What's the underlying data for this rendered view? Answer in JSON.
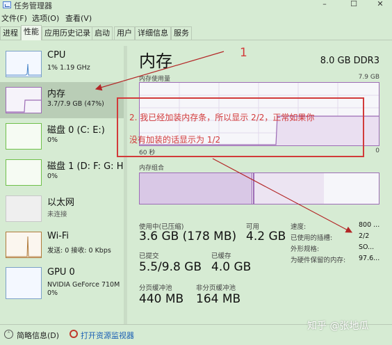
{
  "window": {
    "title": "任务管理器",
    "controls": [
      "–",
      "☐",
      "✕"
    ]
  },
  "menu": [
    "文件(F)",
    "选项(O)",
    "查看(V)"
  ],
  "tabs": [
    "进程",
    "性能",
    "应用历史记录",
    "启动",
    "用户",
    "详细信息",
    "服务"
  ],
  "active_tab": "性能",
  "sidebar": {
    "items": [
      {
        "title": "CPU",
        "sub": "1%  1.19 GHz",
        "sub2": ""
      },
      {
        "title": "内存",
        "sub": "3.7/7.9 GB (47%)",
        "sub2": ""
      },
      {
        "title": "磁盘 0 (C: E:)",
        "sub": "0%",
        "sub2": ""
      },
      {
        "title": "磁盘 1 (D: F: G: H",
        "sub": "0%",
        "sub2": ""
      },
      {
        "title": "以太网",
        "sub": "未连接",
        "sub2": ""
      },
      {
        "title": "Wi-Fi",
        "sub": "发送: 0  接收: 0 Kbps",
        "sub2": ""
      },
      {
        "title": "GPU 0",
        "sub": "NVIDIA GeForce 710M",
        "sub2": "0%"
      }
    ],
    "selected_index": 1
  },
  "main": {
    "title": "内存",
    "spec": "8.0 GB DDR3",
    "usage_label": "内存使用量",
    "usage_max": "7.9 GB",
    "usage_fraction": 0.47,
    "x_left": "60 秒",
    "x_right": "0",
    "composition_label": "内存组合",
    "stats": {
      "in_use_label": "使用中(已压缩)",
      "in_use_value": "3.6 GB (178 MB)",
      "available_label": "可用",
      "available_value": "4.2 GB",
      "committed_label": "已提交",
      "committed_value": "5.5/9.8 GB",
      "cached_label": "已缓存",
      "cached_value": "4.0 GB",
      "paged_label": "分页缓冲池",
      "paged_value": "440 MB",
      "nonpaged_label": "非分页缓冲池",
      "nonpaged_value": "164 MB"
    },
    "details": [
      {
        "key": "速度:",
        "value": "800 ..."
      },
      {
        "key": "已使用的插槽:",
        "value": "2/2"
      },
      {
        "key": "外形规格:",
        "value": "SO..."
      },
      {
        "key": "为硬件保留的内存:",
        "value": "97.6..."
      }
    ]
  },
  "footer": {
    "fewer_details": "简略信息(D)",
    "open_monitor": "打开资源监视器"
  },
  "annotation": {
    "number": "1",
    "line1": "2. 我已经加装内存条，所以显示 2/2，正常如果你",
    "line2": "没有加装的话显示为 1/2",
    "color": "#d23a3a"
  },
  "watermark": "知乎 @张地瓜",
  "colors": {
    "background": "#d6ebd3",
    "memory_border": "#9c6bb5",
    "cpu_border": "#7aa0c8",
    "disk_border": "#6fbf4a",
    "wifi_border": "#b07a3a"
  }
}
